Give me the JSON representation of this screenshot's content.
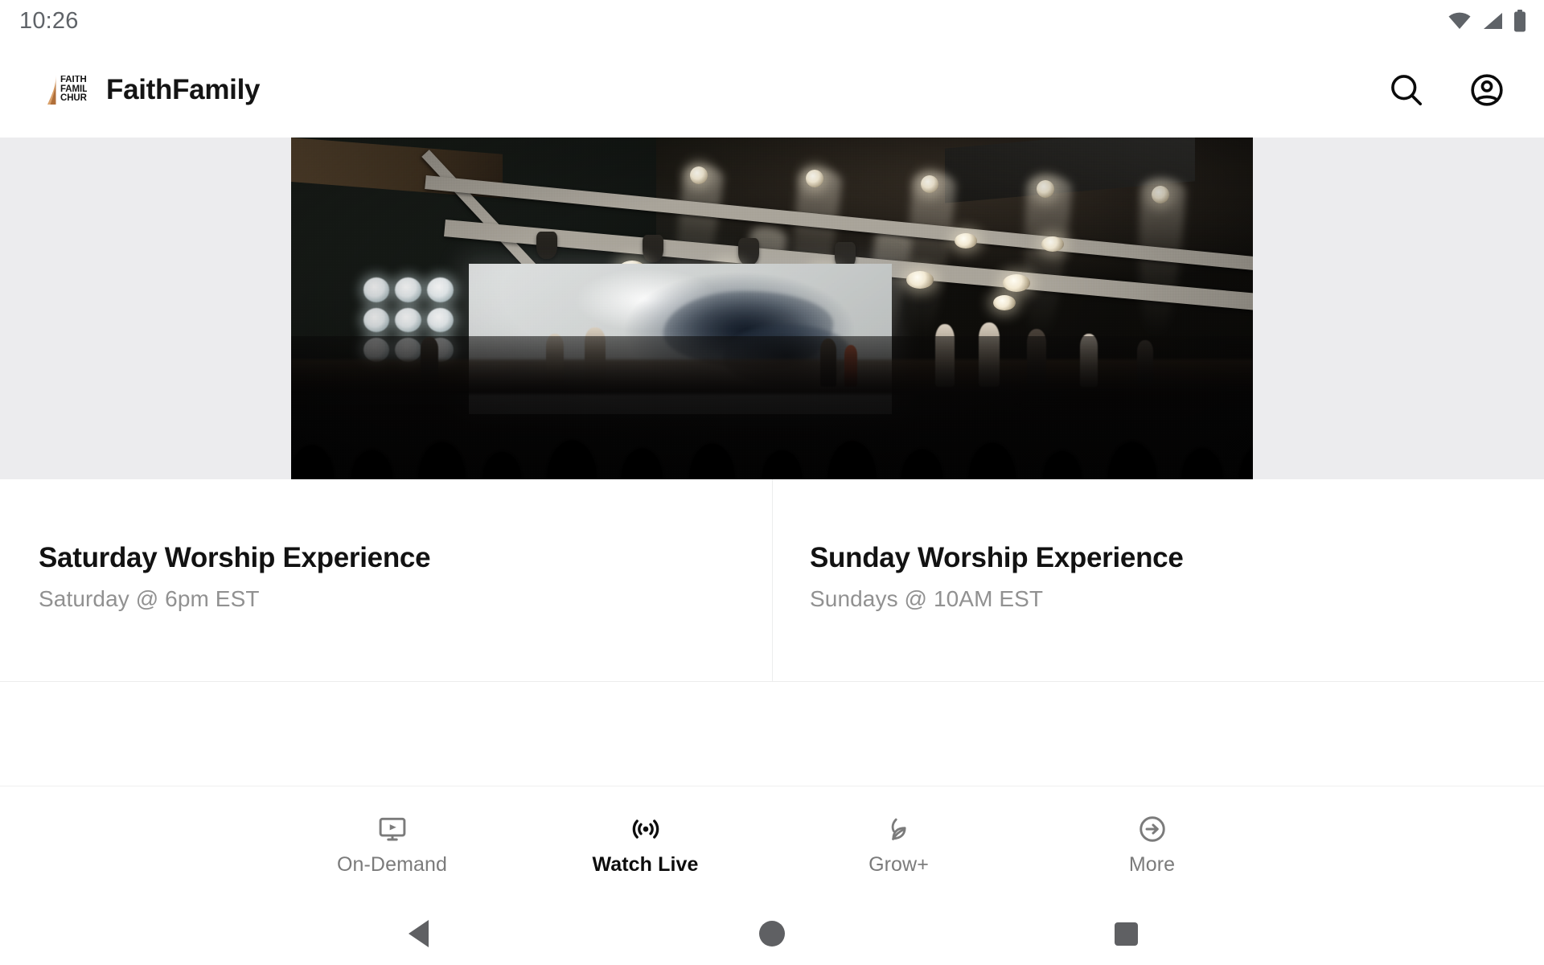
{
  "status_bar": {
    "time": "10:26",
    "icons": [
      "wifi-icon",
      "cellular-signal-icon",
      "battery-icon"
    ]
  },
  "app_bar": {
    "brand_title": "FaithFamily",
    "logo": {
      "name": "faithfamily-church-logo",
      "flame_color": "#d9a06a",
      "lines": [
        "FAITH",
        "FAMIL",
        "CHUR"
      ]
    },
    "actions": [
      {
        "name": "search-button",
        "icon": "search-icon",
        "label": "Search"
      },
      {
        "name": "account-button",
        "icon": "account-circle-icon",
        "label": "Account"
      }
    ]
  },
  "hero": {
    "name": "live-stream-hero-image",
    "alt": "Worship band performing on a concert stage with stage lighting truss and a silhouetted crowd",
    "background_color": "#ececee"
  },
  "events": [
    {
      "title": "Saturday Worship Experience",
      "subtitle": "Saturday @ 6pm EST"
    },
    {
      "title": "Sunday Worship Experience",
      "subtitle": "Sundays @ 10AM EST"
    }
  ],
  "bottom_nav": {
    "items": [
      {
        "label": "On-Demand",
        "icon": "on-demand-tv-play-icon",
        "active": false
      },
      {
        "label": "Watch Live",
        "icon": "live-broadcast-icon",
        "active": true
      },
      {
        "label": "Grow+",
        "icon": "leaf-sprout-icon",
        "active": false
      },
      {
        "label": "More",
        "icon": "arrow-right-circle-icon",
        "active": false
      }
    ],
    "active_color": "#0d0d0d",
    "inactive_color": "#7b7b7b"
  },
  "system_nav": {
    "buttons": [
      {
        "name": "back-button",
        "icon": "triangle-back-icon"
      },
      {
        "name": "home-button",
        "icon": "circle-home-icon"
      },
      {
        "name": "recents-button",
        "icon": "square-recents-icon"
      }
    ],
    "color": "#5f6063"
  }
}
